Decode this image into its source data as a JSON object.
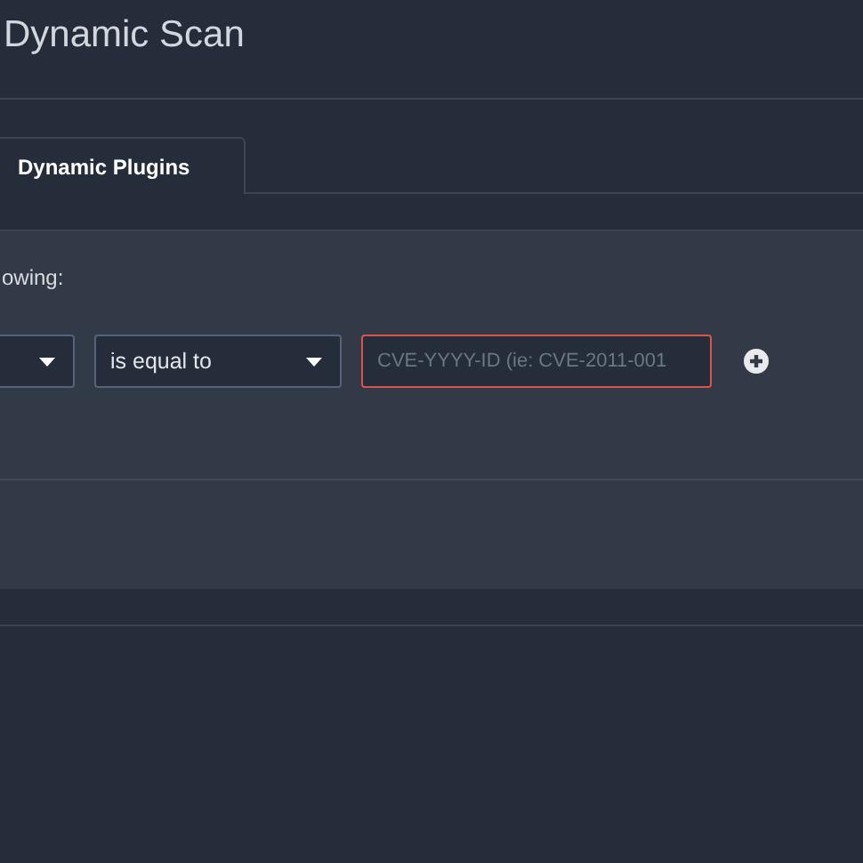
{
  "page": {
    "title": "Dynamic Scan"
  },
  "tabs": [
    {
      "label": "Dynamic Plugins",
      "selected": true
    }
  ],
  "filter_panel": {
    "prompt": "owing:",
    "controls": [
      {
        "kind": "select"
      },
      {
        "kind": "select",
        "value": "is equal to"
      },
      {
        "kind": "text",
        "placeholder": "CVE-YYYY-ID (ie: CVE-2011-001",
        "invalid": true
      },
      {
        "kind": "add"
      }
    ]
  }
}
